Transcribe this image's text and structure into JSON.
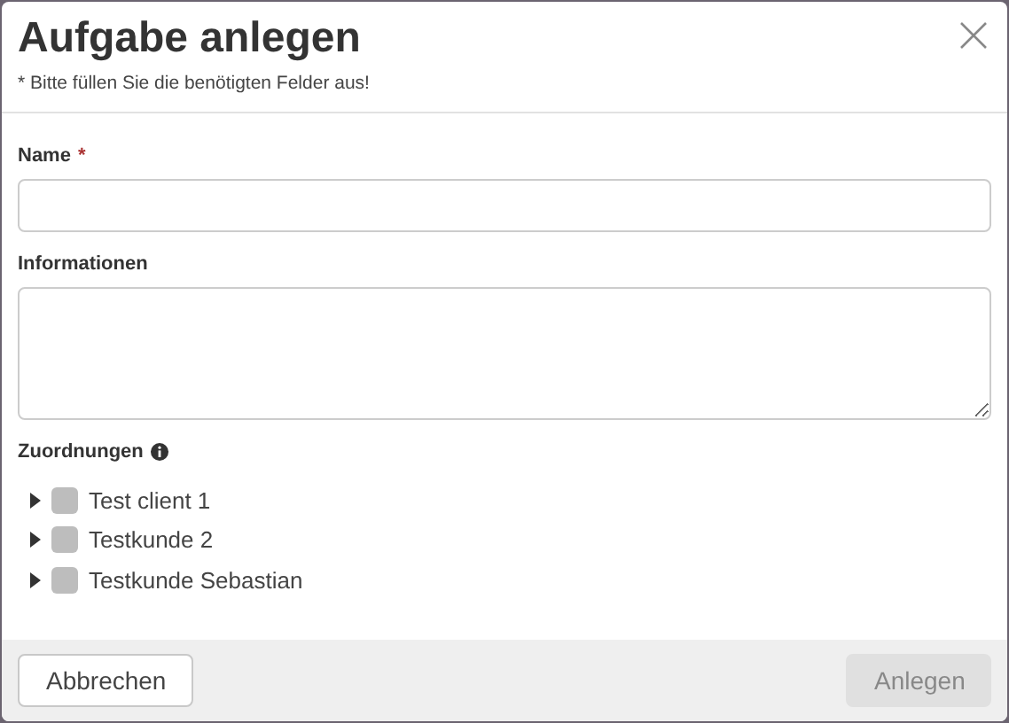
{
  "dialog": {
    "title": "Aufgabe anlegen",
    "required_note": "* Bitte füllen Sie die benötigten Felder aus!"
  },
  "fields": [
    {
      "kind": "input",
      "label": "Name",
      "required_mark": "*"
    },
    {
      "kind": "textarea",
      "label": "Informationen"
    }
  ],
  "assignments": {
    "label": "Zuordnungen",
    "items": [
      {
        "label": "Test client 1",
        "checked": false,
        "expanded": false
      },
      {
        "label": "Testkunde 2",
        "checked": false,
        "expanded": false
      },
      {
        "label": "Testkunde Sebastian",
        "checked": false,
        "expanded": false
      }
    ]
  },
  "buttons": [
    {
      "label": "Abbrechen",
      "disabled": false
    },
    {
      "label": "Anlegen",
      "disabled": true
    }
  ]
}
